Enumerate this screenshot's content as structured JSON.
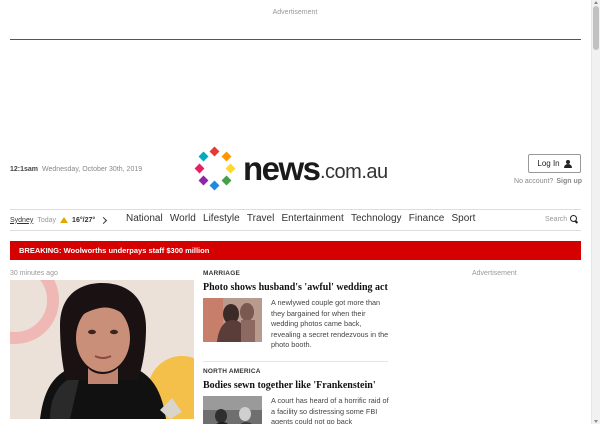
{
  "ad_top": {
    "label": "Advertisement"
  },
  "header": {
    "time": "12:1sam",
    "date": "Wednesday, October 30th, 2019",
    "logo_word": "news",
    "logo_tld": ".com.au",
    "login_label": "Log In",
    "no_account": "No account?",
    "signup_label": "Sign up"
  },
  "weather": {
    "city": "Sydney",
    "today": "Today",
    "temps": "16°/27°"
  },
  "nav": {
    "items": [
      "National",
      "World",
      "Lifestyle",
      "Travel",
      "Entertainment",
      "Technology",
      "Finance",
      "Sport"
    ],
    "search_label": "Search"
  },
  "breaking": {
    "text": "BREAKING: Woolworths underpays staff $300 million"
  },
  "lead": {
    "time": "30 minutes ago"
  },
  "stories": [
    {
      "category": "MARRIAGE",
      "headline": "Photo shows husband's 'awful' wedding act",
      "text": "A newlywed couple got more than they bargained for when their wedding photos came back, revealing a secret rendezvous in the photo booth."
    },
    {
      "category": "NORTH AMERICA",
      "headline": "Bodies sewn together like 'Frankenstein'",
      "text": "A court has heard of a horrific raid of a facility so distressing some FBI agents could not go back"
    }
  ],
  "side_ad": {
    "label": "Advertisement"
  },
  "colors": {
    "breaking_red": "#d50000",
    "logo_dots": [
      "#e53935",
      "#ff9800",
      "#fdd835",
      "#43a047",
      "#1e88e5",
      "#8e24aa",
      "#e91e63",
      "#00acc1"
    ]
  }
}
